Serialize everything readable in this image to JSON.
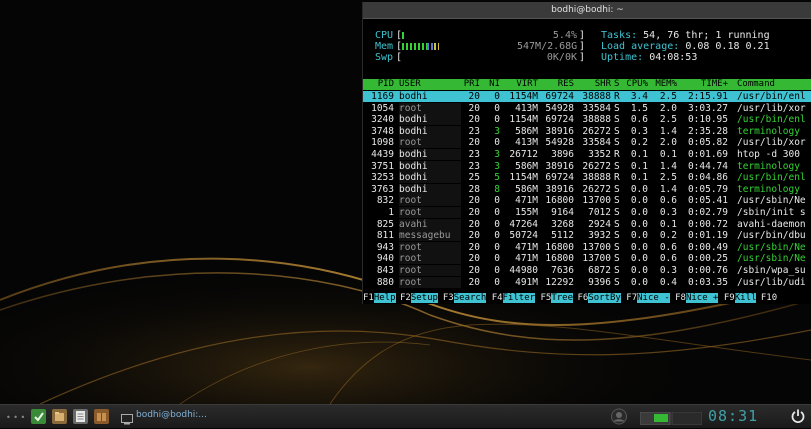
{
  "window": {
    "title": "bodhi@bodhi: ~"
  },
  "meters": {
    "cpu": {
      "label": "CPU",
      "value": "5.4%",
      "green_fraction": 0.02,
      "blue_fraction": 0.0
    },
    "mem": {
      "label": "Mem",
      "value": "547M/2.68G",
      "green_fraction": 0.14,
      "blue_fraction": 0.04,
      "yellow_fraction": 0.03
    },
    "swp": {
      "label": "Swp",
      "value": "0K/0K",
      "green_fraction": 0.0
    }
  },
  "stats": {
    "tasks_label": "Tasks:",
    "tasks_value": "54, 76 thr; 1 running",
    "load_label": "Load average:",
    "load_value": "0.08 0.18 0.21",
    "uptime_label": "Uptime:",
    "uptime_value": "04:08:53"
  },
  "table": {
    "columns": [
      "PID",
      "USER",
      "PRI",
      "NI",
      "VIRT",
      "RES",
      "SHR",
      "S",
      "CPU%",
      "MEM%",
      "TIME+",
      "Command"
    ],
    "rows": [
      [
        "1169",
        "bodhi",
        "20",
        "0",
        "1154M",
        "69724",
        "38888",
        "R",
        "3.4",
        "2.5",
        "2:15.91",
        "/usr/bin/enl"
      ],
      [
        "1054",
        "root",
        "20",
        "0",
        "413M",
        "54928",
        "33584",
        "S",
        "1.5",
        "2.0",
        "3:03.27",
        "/usr/lib/xor"
      ],
      [
        "3240",
        "bodhi",
        "20",
        "0",
        "1154M",
        "69724",
        "38888",
        "S",
        "0.6",
        "2.5",
        "0:10.95",
        "/usr/bin/enl"
      ],
      [
        "3748",
        "bodhi",
        "23",
        "3",
        "586M",
        "38916",
        "26272",
        "S",
        "0.3",
        "1.4",
        "2:35.28",
        "terminology"
      ],
      [
        "1098",
        "root",
        "20",
        "0",
        "413M",
        "54928",
        "33584",
        "S",
        "0.2",
        "2.0",
        "0:05.82",
        "/usr/lib/xor"
      ],
      [
        "4439",
        "bodhi",
        "23",
        "3",
        "26712",
        "3896",
        "3352",
        "R",
        "0.1",
        "0.1",
        "0:01.69",
        "htop -d 300"
      ],
      [
        "3751",
        "bodhi",
        "23",
        "3",
        "586M",
        "38916",
        "26272",
        "S",
        "0.1",
        "1.4",
        "0:44.74",
        "terminology"
      ],
      [
        "3253",
        "bodhi",
        "25",
        "5",
        "1154M",
        "69724",
        "38888",
        "R",
        "0.1",
        "2.5",
        "0:04.86",
        "/usr/bin/enl"
      ],
      [
        "3763",
        "bodhi",
        "28",
        "8",
        "586M",
        "38916",
        "26272",
        "S",
        "0.0",
        "1.4",
        "0:05.79",
        "terminology"
      ],
      [
        "832",
        "root",
        "20",
        "0",
        "471M",
        "16800",
        "13700",
        "S",
        "0.0",
        "0.6",
        "0:05.41",
        "/usr/sbin/Ne"
      ],
      [
        "1",
        "root",
        "20",
        "0",
        "155M",
        "9164",
        "7012",
        "S",
        "0.0",
        "0.3",
        "0:02.79",
        "/sbin/init s"
      ],
      [
        "825",
        "avahi",
        "20",
        "0",
        "47264",
        "3268",
        "2924",
        "S",
        "0.0",
        "0.1",
        "0:00.72",
        "avahi-daemon"
      ],
      [
        "811",
        "messagebu",
        "20",
        "0",
        "50724",
        "5112",
        "3932",
        "S",
        "0.0",
        "0.2",
        "0:01.19",
        "/usr/bin/dbu"
      ],
      [
        "943",
        "root",
        "20",
        "0",
        "471M",
        "16800",
        "13700",
        "S",
        "0.0",
        "0.6",
        "0:00.49",
        "/usr/sbin/Ne"
      ],
      [
        "940",
        "root",
        "20",
        "0",
        "471M",
        "16800",
        "13700",
        "S",
        "0.0",
        "0.6",
        "0:00.25",
        "/usr/sbin/Ne"
      ],
      [
        "843",
        "root",
        "20",
        "0",
        "44980",
        "7636",
        "6872",
        "S",
        "0.0",
        "0.3",
        "0:00.76",
        "/sbin/wpa_su"
      ],
      [
        "880",
        "root",
        "20",
        "0",
        "491M",
        "12292",
        "9396",
        "S",
        "0.0",
        "0.4",
        "0:03.35",
        "/usr/lib/udi"
      ]
    ],
    "green_command_rows": [
      2,
      3,
      6,
      7,
      8,
      13,
      14
    ]
  },
  "fkeys": [
    {
      "key": "F1",
      "label": "Help"
    },
    {
      "key": "F2",
      "label": "Setup"
    },
    {
      "key": "F3",
      "label": "Search"
    },
    {
      "key": "F4",
      "label": "Filter"
    },
    {
      "key": "F5",
      "label": "Tree"
    },
    {
      "key": "F6",
      "label": "SortBy"
    },
    {
      "key": "F7",
      "label": "Nice -"
    },
    {
      "key": "F8",
      "label": "Nice +"
    },
    {
      "key": "F9",
      "label": "Kill"
    },
    {
      "key": "F10",
      "label": ""
    }
  ],
  "taskbar": {
    "task_label": "bodhi@bodhi:...",
    "clock": "08:31",
    "launchers": [
      "settings-icon",
      "files-icon",
      "notes-icon",
      "package-icon"
    ]
  },
  "colors": {
    "cyan": "#3fc3d2",
    "green": "#35d235",
    "header_green": "#35b935"
  }
}
